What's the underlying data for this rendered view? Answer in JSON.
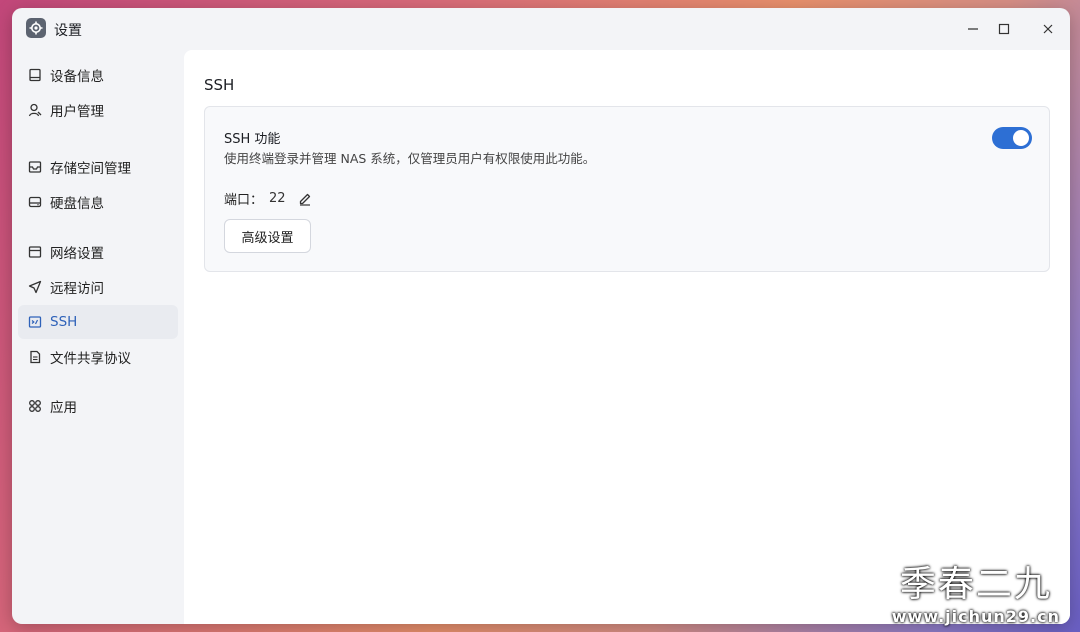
{
  "window": {
    "title": "设置",
    "app_icon": "gear-icon"
  },
  "sidebar": {
    "items": [
      {
        "label": "设备信息",
        "icon": "device-icon"
      },
      {
        "label": "用户管理",
        "icon": "user-icon"
      },
      {
        "label": "存储空间管理",
        "icon": "storage-icon"
      },
      {
        "label": "硬盘信息",
        "icon": "disk-icon"
      },
      {
        "label": "网络设置",
        "icon": "network-icon"
      },
      {
        "label": "远程访问",
        "icon": "remote-icon"
      },
      {
        "label": "SSH",
        "icon": "terminal-icon",
        "active": true
      },
      {
        "label": "文件共享协议",
        "icon": "document-icon"
      },
      {
        "label": "应用",
        "icon": "apps-icon"
      }
    ]
  },
  "main": {
    "title": "SSH",
    "card": {
      "feature_title": "SSH 功能",
      "description": "使用终端登录并管理 NAS 系统，仅管理员用户有权限使用此功能。",
      "enabled": true,
      "port_label": "端口：",
      "port_value": "22",
      "advanced_button": "高级设置"
    }
  },
  "watermark": {
    "title": "季春二九",
    "url": "www.jichun29.cn"
  },
  "colors": {
    "accent": "#2d6fd4",
    "active_nav_text": "#2f62b9",
    "toggle_on": "#2d6fd4"
  }
}
